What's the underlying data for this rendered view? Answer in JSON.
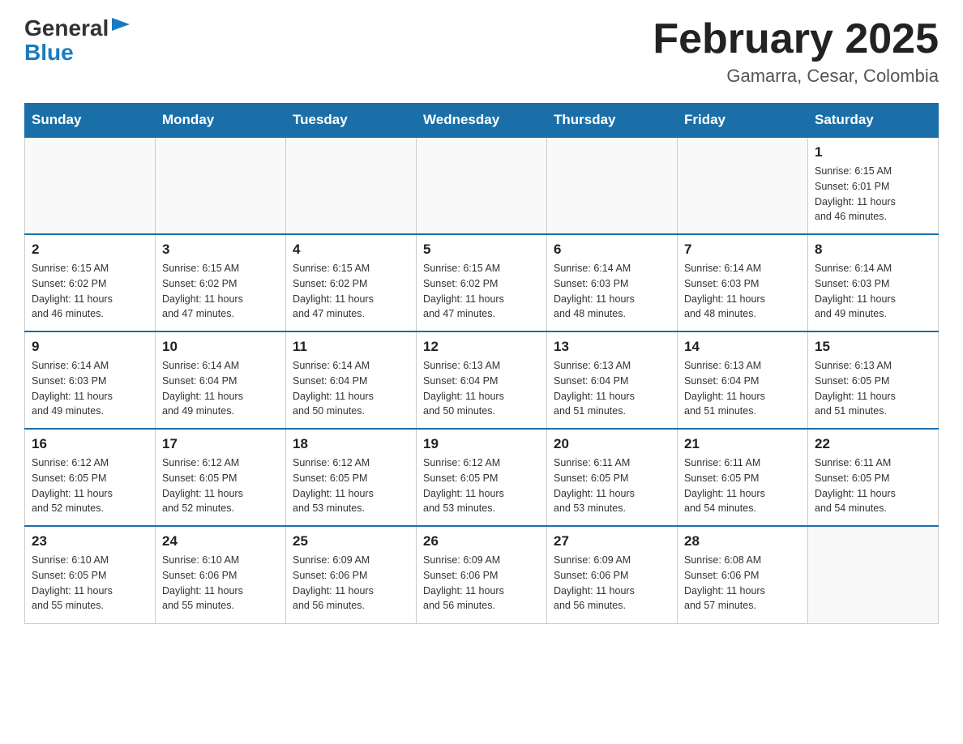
{
  "logo": {
    "general": "General",
    "blue": "Blue"
  },
  "title": {
    "month": "February 2025",
    "location": "Gamarra, Cesar, Colombia"
  },
  "days_of_week": [
    "Sunday",
    "Monday",
    "Tuesday",
    "Wednesday",
    "Thursday",
    "Friday",
    "Saturday"
  ],
  "weeks": [
    [
      {
        "day": "",
        "info": ""
      },
      {
        "day": "",
        "info": ""
      },
      {
        "day": "",
        "info": ""
      },
      {
        "day": "",
        "info": ""
      },
      {
        "day": "",
        "info": ""
      },
      {
        "day": "",
        "info": ""
      },
      {
        "day": "1",
        "info": "Sunrise: 6:15 AM\nSunset: 6:01 PM\nDaylight: 11 hours\nand 46 minutes."
      }
    ],
    [
      {
        "day": "2",
        "info": "Sunrise: 6:15 AM\nSunset: 6:02 PM\nDaylight: 11 hours\nand 46 minutes."
      },
      {
        "day": "3",
        "info": "Sunrise: 6:15 AM\nSunset: 6:02 PM\nDaylight: 11 hours\nand 47 minutes."
      },
      {
        "day": "4",
        "info": "Sunrise: 6:15 AM\nSunset: 6:02 PM\nDaylight: 11 hours\nand 47 minutes."
      },
      {
        "day": "5",
        "info": "Sunrise: 6:15 AM\nSunset: 6:02 PM\nDaylight: 11 hours\nand 47 minutes."
      },
      {
        "day": "6",
        "info": "Sunrise: 6:14 AM\nSunset: 6:03 PM\nDaylight: 11 hours\nand 48 minutes."
      },
      {
        "day": "7",
        "info": "Sunrise: 6:14 AM\nSunset: 6:03 PM\nDaylight: 11 hours\nand 48 minutes."
      },
      {
        "day": "8",
        "info": "Sunrise: 6:14 AM\nSunset: 6:03 PM\nDaylight: 11 hours\nand 49 minutes."
      }
    ],
    [
      {
        "day": "9",
        "info": "Sunrise: 6:14 AM\nSunset: 6:03 PM\nDaylight: 11 hours\nand 49 minutes."
      },
      {
        "day": "10",
        "info": "Sunrise: 6:14 AM\nSunset: 6:04 PM\nDaylight: 11 hours\nand 49 minutes."
      },
      {
        "day": "11",
        "info": "Sunrise: 6:14 AM\nSunset: 6:04 PM\nDaylight: 11 hours\nand 50 minutes."
      },
      {
        "day": "12",
        "info": "Sunrise: 6:13 AM\nSunset: 6:04 PM\nDaylight: 11 hours\nand 50 minutes."
      },
      {
        "day": "13",
        "info": "Sunrise: 6:13 AM\nSunset: 6:04 PM\nDaylight: 11 hours\nand 51 minutes."
      },
      {
        "day": "14",
        "info": "Sunrise: 6:13 AM\nSunset: 6:04 PM\nDaylight: 11 hours\nand 51 minutes."
      },
      {
        "day": "15",
        "info": "Sunrise: 6:13 AM\nSunset: 6:05 PM\nDaylight: 11 hours\nand 51 minutes."
      }
    ],
    [
      {
        "day": "16",
        "info": "Sunrise: 6:12 AM\nSunset: 6:05 PM\nDaylight: 11 hours\nand 52 minutes."
      },
      {
        "day": "17",
        "info": "Sunrise: 6:12 AM\nSunset: 6:05 PM\nDaylight: 11 hours\nand 52 minutes."
      },
      {
        "day": "18",
        "info": "Sunrise: 6:12 AM\nSunset: 6:05 PM\nDaylight: 11 hours\nand 53 minutes."
      },
      {
        "day": "19",
        "info": "Sunrise: 6:12 AM\nSunset: 6:05 PM\nDaylight: 11 hours\nand 53 minutes."
      },
      {
        "day": "20",
        "info": "Sunrise: 6:11 AM\nSunset: 6:05 PM\nDaylight: 11 hours\nand 53 minutes."
      },
      {
        "day": "21",
        "info": "Sunrise: 6:11 AM\nSunset: 6:05 PM\nDaylight: 11 hours\nand 54 minutes."
      },
      {
        "day": "22",
        "info": "Sunrise: 6:11 AM\nSunset: 6:05 PM\nDaylight: 11 hours\nand 54 minutes."
      }
    ],
    [
      {
        "day": "23",
        "info": "Sunrise: 6:10 AM\nSunset: 6:05 PM\nDaylight: 11 hours\nand 55 minutes."
      },
      {
        "day": "24",
        "info": "Sunrise: 6:10 AM\nSunset: 6:06 PM\nDaylight: 11 hours\nand 55 minutes."
      },
      {
        "day": "25",
        "info": "Sunrise: 6:09 AM\nSunset: 6:06 PM\nDaylight: 11 hours\nand 56 minutes."
      },
      {
        "day": "26",
        "info": "Sunrise: 6:09 AM\nSunset: 6:06 PM\nDaylight: 11 hours\nand 56 minutes."
      },
      {
        "day": "27",
        "info": "Sunrise: 6:09 AM\nSunset: 6:06 PM\nDaylight: 11 hours\nand 56 minutes."
      },
      {
        "day": "28",
        "info": "Sunrise: 6:08 AM\nSunset: 6:06 PM\nDaylight: 11 hours\nand 57 minutes."
      },
      {
        "day": "",
        "info": ""
      }
    ]
  ]
}
